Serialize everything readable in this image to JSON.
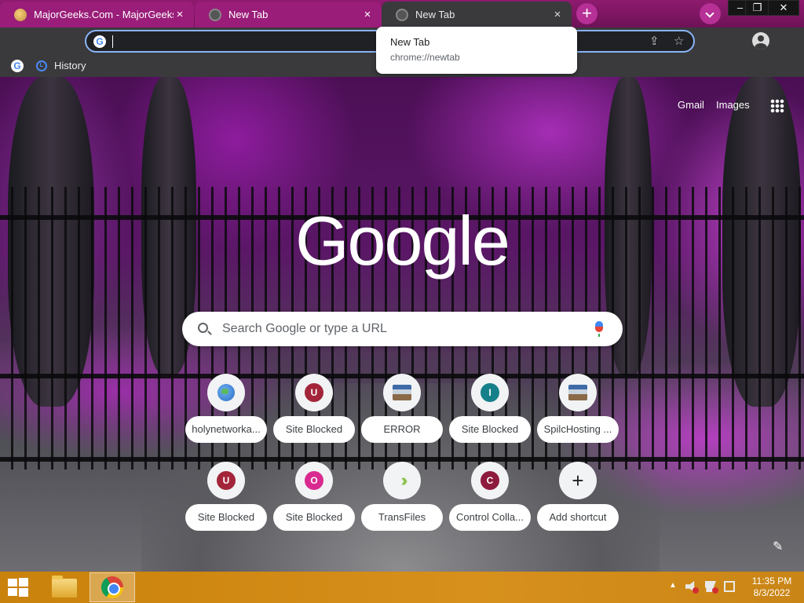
{
  "tabs": [
    {
      "title": "MajorGeeks.Com - MajorGeeks",
      "close": "×"
    },
    {
      "title": "New Tab",
      "close": "×"
    },
    {
      "title": "New Tab",
      "close": "×"
    }
  ],
  "window_controls": {
    "new_tab": "+",
    "minimize": "–",
    "maximize": "❐",
    "close": "✕"
  },
  "omnibox": {
    "value": ""
  },
  "bookmarks": {
    "history": "History"
  },
  "hover_card": {
    "title": "New Tab",
    "url": "chrome://newtab"
  },
  "ntp": {
    "gmail": "Gmail",
    "images": "Images",
    "logo": "Google",
    "search_placeholder": "Search Google or type a URL",
    "shortcuts": [
      {
        "label": "holynetworka...",
        "icon": "globe",
        "color": "#2b6cc4"
      },
      {
        "label": "Site Blocked",
        "icon": "U",
        "color": "#a3253a"
      },
      {
        "label": "ERROR",
        "icon": "thumbnail",
        "color": "#3e6aa8"
      },
      {
        "label": "Site Blocked",
        "icon": "I",
        "color": "#16808a"
      },
      {
        "label": "SpilcHosting ...",
        "icon": "thumbnail",
        "color": "#3e6aa8"
      },
      {
        "label": "Site Blocked",
        "icon": "U",
        "color": "#a3253a"
      },
      {
        "label": "Site Blocked",
        "icon": "O",
        "color": "#d92b8f"
      },
      {
        "label": "TransFiles",
        "icon": "arrows",
        "color": "#8bc34a"
      },
      {
        "label": "Control Colla...",
        "icon": "C",
        "color": "#8e1a3e"
      },
      {
        "label": "Add shortcut",
        "icon": "+",
        "color": "#202124"
      }
    ]
  },
  "taskbar": {
    "time": "11:35 PM",
    "date": "8/3/2022"
  },
  "colors": {
    "accent": "#8ab4f8",
    "tabstrip": "#8e1a6e",
    "taskbar": "#d7901c"
  }
}
